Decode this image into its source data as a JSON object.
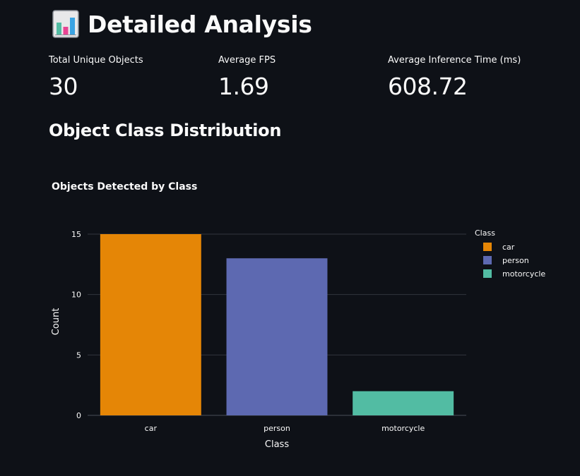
{
  "page": {
    "title": "Detailed Analysis",
    "title_icon": "bar-chart-icon"
  },
  "metrics": [
    {
      "label": "Total Unique Objects",
      "value": "30"
    },
    {
      "label": "Average FPS",
      "value": "1.69"
    },
    {
      "label": "Average Inference Time (ms)",
      "value": "608.72"
    }
  ],
  "section": {
    "title": "Object Class Distribution"
  },
  "chart_data": {
    "type": "bar",
    "title": "Objects Detected by Class",
    "xlabel": "Class",
    "ylabel": "Count",
    "categories": [
      "car",
      "person",
      "motorcycle"
    ],
    "values": [
      15,
      13,
      2
    ],
    "colors": [
      "#e58606",
      "#5d69b1",
      "#52bca3"
    ],
    "ylim": [
      0,
      15
    ],
    "yticks": [
      0,
      5,
      10,
      15
    ],
    "grid": true,
    "legend": {
      "title": "Class",
      "placement": "right",
      "entries": [
        "car",
        "person",
        "motorcycle"
      ]
    }
  }
}
